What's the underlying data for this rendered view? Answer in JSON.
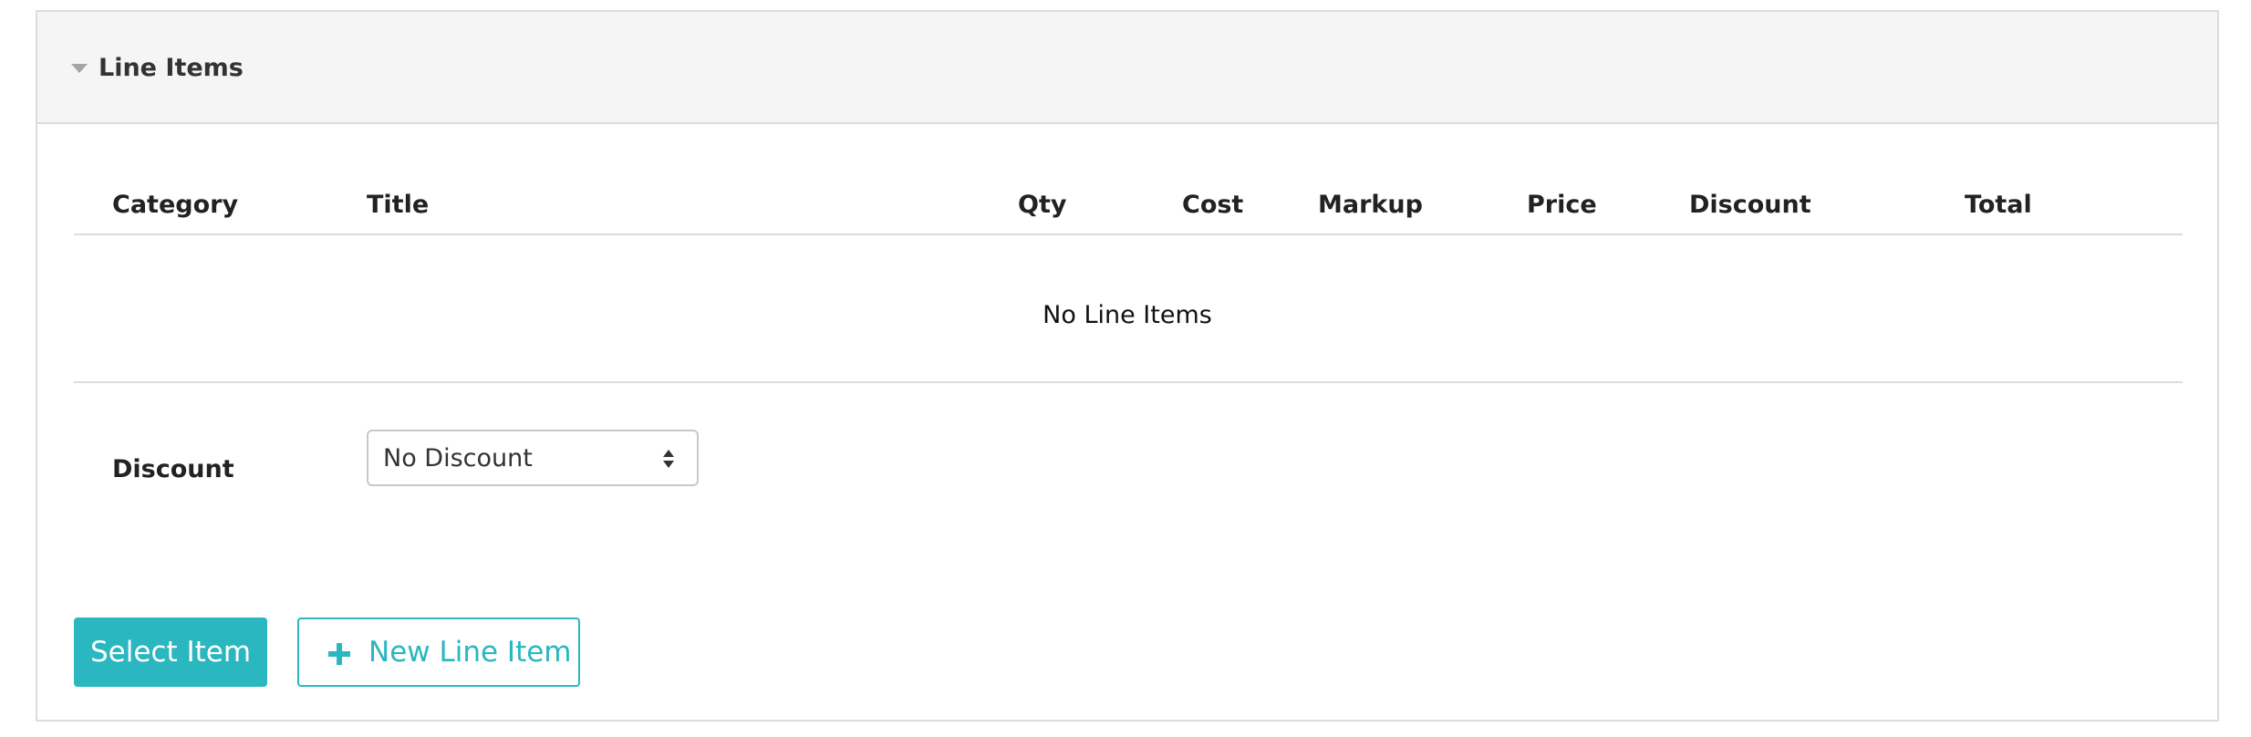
{
  "panel": {
    "title": "Line Items"
  },
  "table": {
    "columns": {
      "category": "Category",
      "title": "Title",
      "qty": "Qty",
      "cost": "Cost",
      "markup": "Markup",
      "price": "Price",
      "discount": "Discount",
      "total": "Total"
    },
    "empty_message": "No Line Items"
  },
  "discount": {
    "label": "Discount",
    "selected": "No Discount"
  },
  "actions": {
    "select_item": "Select Item",
    "new_line_item": "New Line Item"
  },
  "icons": {
    "collapse": "caret-down-icon",
    "select": "sort-arrows-icon",
    "add": "plus-icon"
  },
  "colors": {
    "accent": "#2ab7bf",
    "header_bg": "#f5f5f5",
    "border": "#dcdcdc"
  }
}
